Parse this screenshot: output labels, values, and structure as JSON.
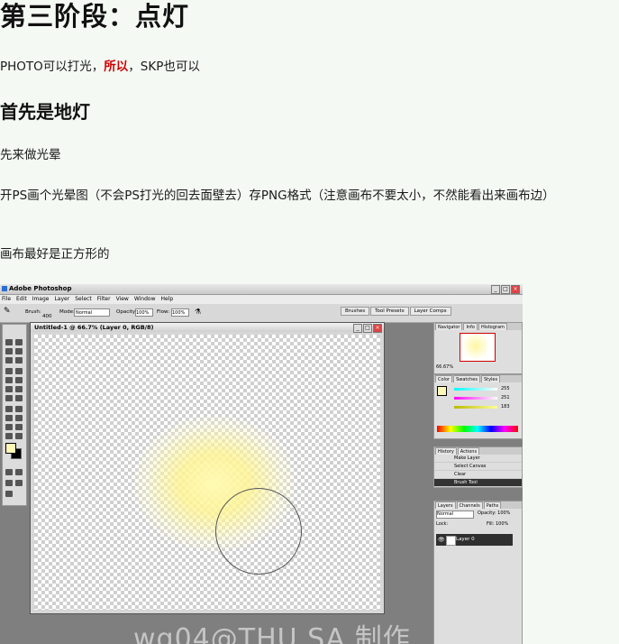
{
  "heading_main": "第三阶段：点灯",
  "para1": {
    "before": "PHOTO可以打光，",
    "emph": "所以",
    "after": "，SKP也可以"
  },
  "heading_sub": "首先是地灯",
  "para2": "先来做光晕",
  "para3": "开PS画个光晕图（不会PS打光的回去面壁去）存PNG格式（注意画布不要太小，不然能看出来画布边）",
  "para4": "画布最好是正方形的",
  "screenshot": {
    "app_title": "Adobe Photoshop",
    "menu": [
      "File",
      "Edit",
      "Image",
      "Layer",
      "Select",
      "Filter",
      "View",
      "Window",
      "Help"
    ],
    "options": {
      "brush": "Brush:",
      "brush_size": "400",
      "mode": "Mode:",
      "mode_value": "Normal",
      "opacity": "Opacity:",
      "opacity_value": "100%",
      "flow": "Flow:",
      "flow_value": "100%"
    },
    "palette_tabs": [
      "Brushes",
      "Tool Presets",
      "Layer Comps"
    ],
    "doc_title": "Untitled-1 @ 66.7% (Layer 0, RGB/8)",
    "navigator_tabs": [
      "Navigator",
      "Info",
      "Histogram"
    ],
    "zoom": "66.67%",
    "color_tabs": [
      "Color",
      "Swatches",
      "Styles"
    ],
    "color_values": {
      "r": "255",
      "g": "251",
      "b": "183"
    },
    "history_tabs": [
      "History",
      "Actions"
    ],
    "history_items": [
      "Make Layer",
      "Select Canvas",
      "Clear",
      "Brush Tool"
    ],
    "layers_tabs": [
      "Layers",
      "Channels",
      "Paths"
    ],
    "blend_mode": "Normal",
    "layer_opacity": "Opacity: 100%",
    "lock": "Lock:",
    "fill": "Fill: 100%",
    "layer_name": "Layer 0",
    "watermark": "wq04@THU SA 制作",
    "colors": {
      "fg": "#fff8b8",
      "bg": "#000000"
    }
  }
}
